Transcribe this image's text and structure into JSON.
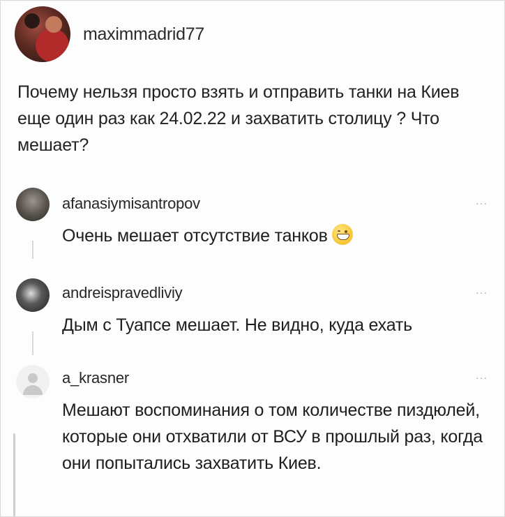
{
  "post": {
    "username": "maximmadrid77",
    "text": "Почему нельзя просто взять и отправить танки на Киев еще один раз как 24.02.22 и захватить столицу ? Что мешает?"
  },
  "comments": [
    {
      "username": "afanasiymisantropov",
      "text": "Очень мешает отсутствие танков",
      "emoji": "grinning-face-icon",
      "more": "···"
    },
    {
      "username": "andreispravedliviy",
      "text": "Дым с Туапсе мешает. Не видно, куда ехать",
      "more": "···"
    },
    {
      "username": "a_krasner",
      "text": "Мешают воспоминания о том количестве пиздюлей, которые они отхватили от ВСУ в прошлый раз, когда они попытались захватить Киев.",
      "more": "···"
    }
  ]
}
